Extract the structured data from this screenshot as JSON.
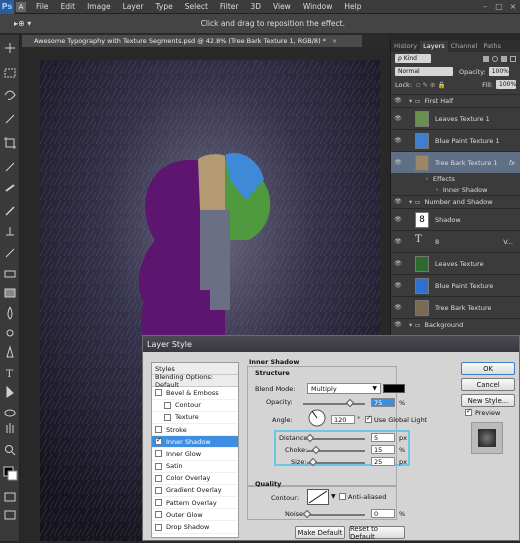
{
  "menubar": {
    "app_icon": "Ps",
    "doc_icon": "A",
    "items": [
      "File",
      "Edit",
      "Image",
      "Layer",
      "Type",
      "Select",
      "Filter",
      "3D",
      "View",
      "Window",
      "Help"
    ]
  },
  "optionsbar": {
    "tool_label": "▸⊕ ▾",
    "hint": "Click and drag to reposition the effect."
  },
  "document": {
    "tab_title": "Awesome Typography with Texture Segments.psd @ 42.8% (Tree Bark Texture 1, RGB/8) *",
    "close": "×"
  },
  "panels": {
    "tabs": [
      "History",
      "Layers",
      "Channel",
      "Paths"
    ],
    "active_tab": "Layers",
    "filter_kind": "ρ Kind",
    "blend_mode": "Normal",
    "opacity_label": "Opacity:",
    "opacity_value": "100%",
    "lock_label": "Lock:",
    "fill_label": "Fill:",
    "fill_value": "100%",
    "layers": [
      {
        "name": "First Half",
        "type": "group"
      },
      {
        "name": "Leaves Texture 1",
        "type": "layer"
      },
      {
        "name": "Blue Paint Texture 1",
        "type": "layer"
      },
      {
        "name": "Tree Bark Texture 1",
        "type": "layer",
        "selected": true,
        "fx": "fx"
      },
      {
        "name": "Effects",
        "type": "sub"
      },
      {
        "name": "Inner Shadow",
        "type": "sub"
      },
      {
        "name": "Number and Shadow",
        "type": "group"
      },
      {
        "name": "Shadow",
        "type": "layer"
      },
      {
        "name": "8",
        "type": "text",
        "extra": "V..."
      },
      {
        "name": "Leaves Texture",
        "type": "layer"
      },
      {
        "name": "Blue Paint Texture",
        "type": "layer"
      },
      {
        "name": "Tree Bark Texture",
        "type": "layer"
      },
      {
        "name": "Background",
        "type": "group"
      }
    ]
  },
  "dialog": {
    "title": "Layer Style",
    "styles_header": "Styles",
    "blending_options": "Blending Options: Default",
    "style_items": [
      {
        "label": "Bevel & Emboss",
        "checked": false,
        "indent": false
      },
      {
        "label": "Contour",
        "checked": false,
        "indent": true
      },
      {
        "label": "Texture",
        "checked": false,
        "indent": true
      },
      {
        "label": "Stroke",
        "checked": false,
        "indent": false
      },
      {
        "label": "Inner Shadow",
        "checked": true,
        "indent": false,
        "selected": true
      },
      {
        "label": "Inner Glow",
        "checked": false,
        "indent": false
      },
      {
        "label": "Satin",
        "checked": false,
        "indent": false
      },
      {
        "label": "Color Overlay",
        "checked": false,
        "indent": false
      },
      {
        "label": "Gradient Overlay",
        "checked": false,
        "indent": false
      },
      {
        "label": "Pattern Overlay",
        "checked": false,
        "indent": false
      },
      {
        "label": "Outer Glow",
        "checked": false,
        "indent": false
      },
      {
        "label": "Drop Shadow",
        "checked": false,
        "indent": false
      }
    ],
    "section_title": "Inner Shadow",
    "structure_title": "Structure",
    "blend_mode_label": "Blend Mode:",
    "blend_mode_value": "Multiply",
    "shadow_color": "#000000",
    "opacity_label": "Opacity:",
    "opacity_value": "75",
    "angle_label": "Angle:",
    "angle_value": "120",
    "angle_unit": "°",
    "global_light_label": "Use Global Light",
    "global_light_checked": true,
    "distance_label": "Distance:",
    "distance_value": "5",
    "choke_label": "Choke:",
    "choke_value": "15",
    "size_label": "Size:",
    "size_value": "25",
    "px": "px",
    "pct": "%",
    "quality_title": "Quality",
    "contour_label": "Contour:",
    "anti_aliased_label": "Anti-aliased",
    "noise_label": "Noise:",
    "noise_value": "0",
    "make_default": "Make Default",
    "reset_default": "Reset to Default",
    "ok": "OK",
    "cancel": "Cancel",
    "new_style": "New Style...",
    "preview_label": "Preview",
    "preview_checked": true,
    "slider_levels": {
      "opacity": 0.75,
      "distance": 0.05,
      "choke": 0.15,
      "size": 0.1,
      "noise": 0.0
    },
    "highlight_color": "#6cc6e6"
  },
  "colors": {
    "purple": "#5e1570",
    "selected_layer": "#5f6f86",
    "selected_style": "#3d8ee0"
  }
}
